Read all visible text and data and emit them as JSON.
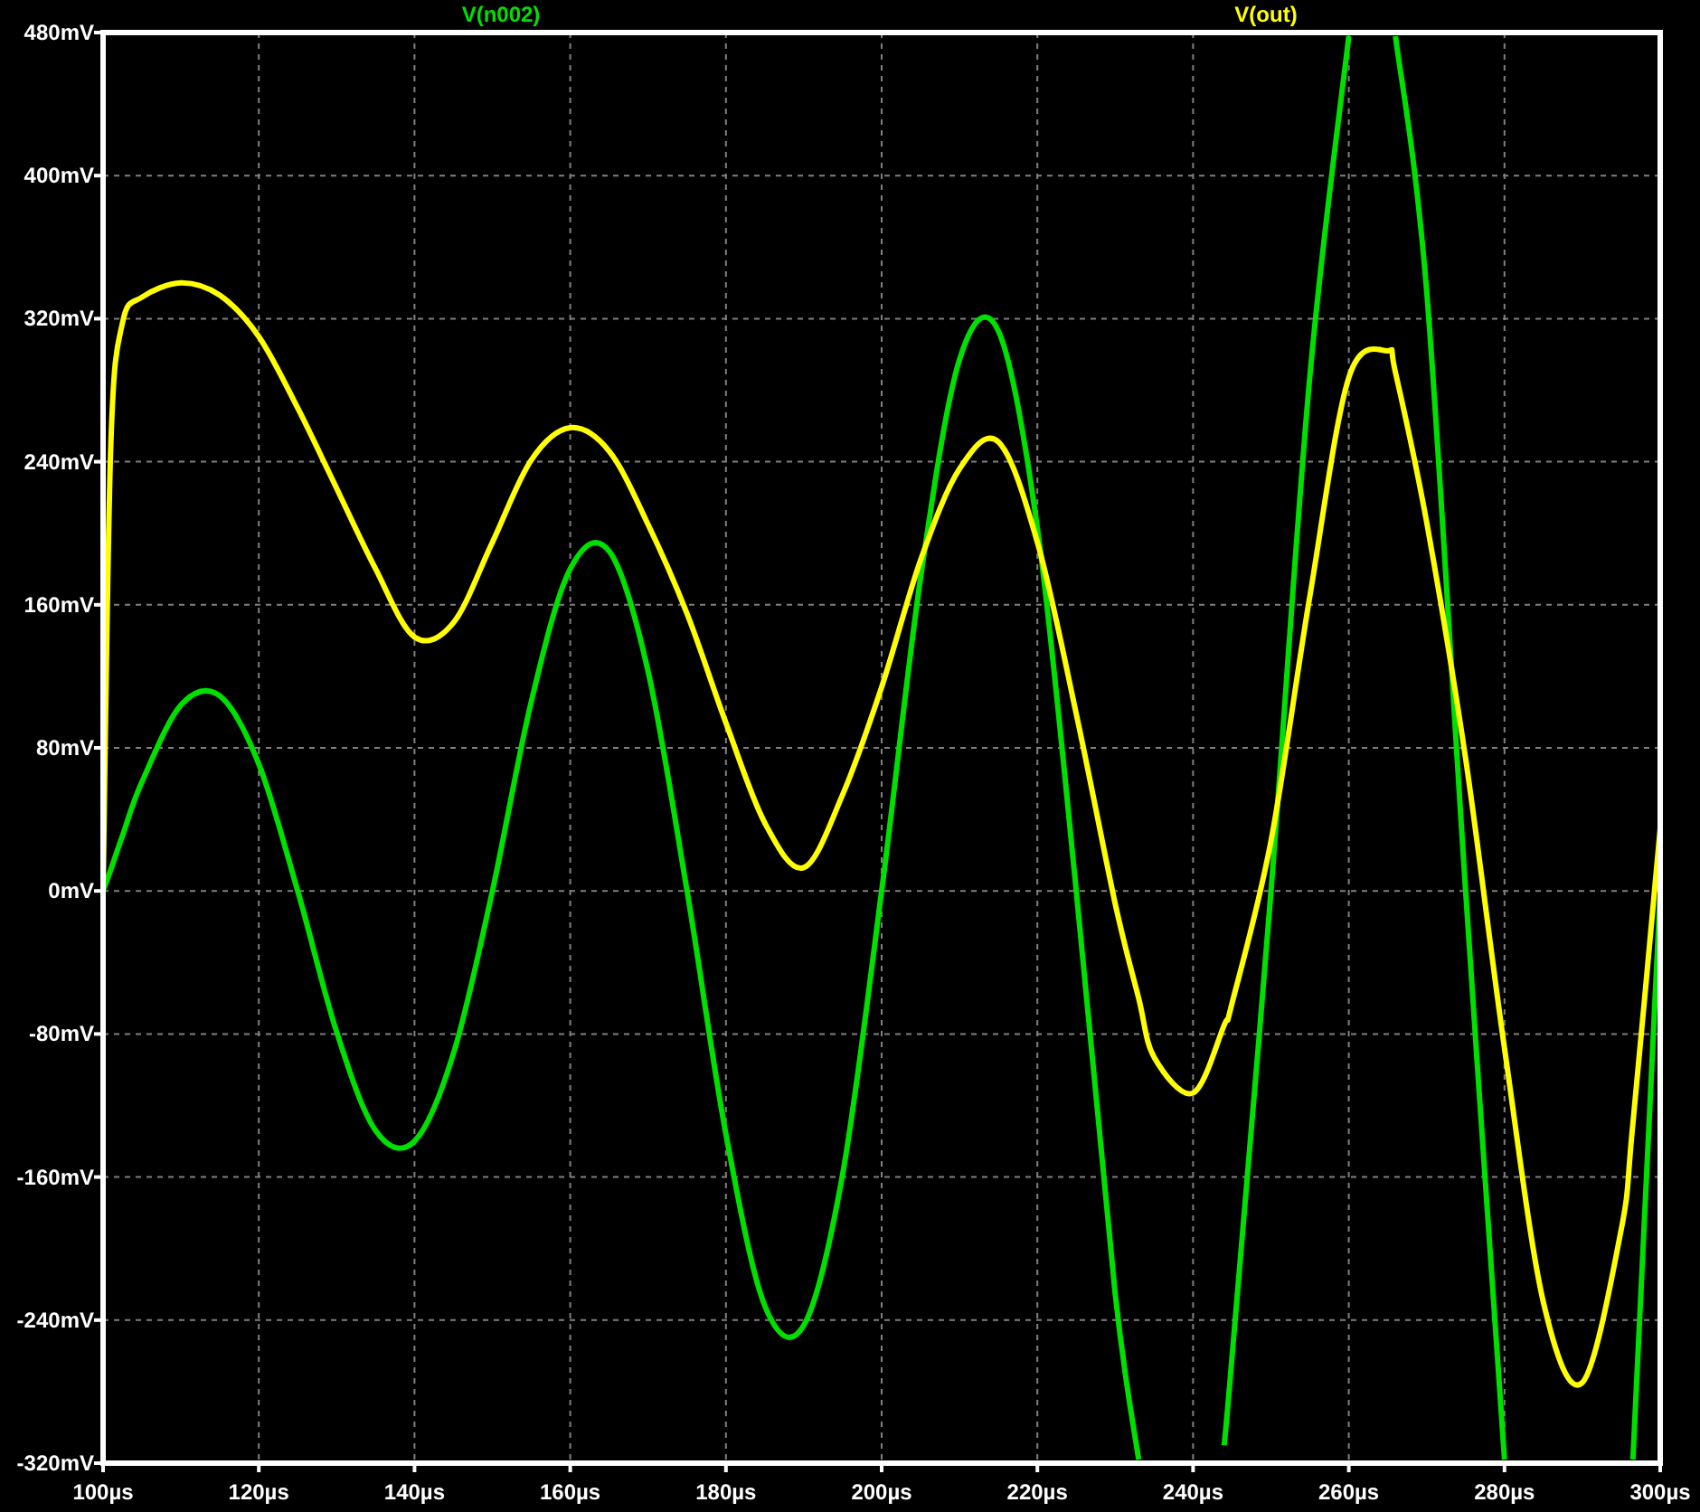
{
  "plot": {
    "chart_data": {
      "type": "line",
      "x": [
        100,
        101,
        102.5,
        105,
        110,
        115,
        120,
        125,
        130,
        135,
        140,
        145,
        150,
        155,
        160,
        165,
        170,
        175,
        180,
        185,
        190,
        195,
        200,
        205,
        210,
        215,
        220,
        225,
        230,
        233,
        235,
        240,
        244,
        245,
        250,
        255,
        260,
        265,
        266,
        270,
        275,
        280,
        285,
        290,
        295,
        296.5,
        300
      ],
      "series": [
        {
          "name": "V(n002)",
          "color": "#00e000",
          "values": [
            0,
            12,
            31,
            61,
            104,
            109,
            71,
            0,
            -79,
            -134,
            -140,
            -91,
            0,
            106,
            180,
            190,
            123,
            0,
            -136,
            -232,
            -243,
            -158,
            0,
            175,
            297,
            313,
            203,
            0,
            -225,
            -318,
            null,
            null,
            -310,
            -261,
            0,
            288,
            478,
            null,
            478,
            335,
            0,
            -318,
            null,
            null,
            null,
            -318,
            0
          ]
        },
        {
          "name": "V(out)",
          "color": "#ffff00",
          "values": [
            0,
            250,
            318,
            332,
            340,
            333,
            310,
            270,
            225,
            180,
            142,
            150,
            195,
            241,
            259,
            246,
            205,
            155,
            94,
            38,
            13,
            54,
            114,
            185,
            236,
            251,
            195,
            99,
            -7,
            -60,
            -93,
            -113,
            -75,
            -63,
            28,
            165,
            287,
            302,
            290,
            206,
            74,
            -88,
            -230,
            -275,
            -189,
            -130,
            35
          ]
        }
      ],
      "xlim": [
        100,
        300
      ],
      "ylim": [
        -320,
        480
      ],
      "grid": true,
      "xticks": [
        {
          "value": 100,
          "label": "100µs"
        },
        {
          "value": 120,
          "label": "120µs"
        },
        {
          "value": 140,
          "label": "140µs"
        },
        {
          "value": 160,
          "label": "160µs"
        },
        {
          "value": 180,
          "label": "180µs"
        },
        {
          "value": 200,
          "label": "200µs"
        },
        {
          "value": 220,
          "label": "220µs"
        },
        {
          "value": 240,
          "label": "240µs"
        },
        {
          "value": 260,
          "label": "260µs"
        },
        {
          "value": 280,
          "label": "280µs"
        },
        {
          "value": 300,
          "label": "300µs"
        }
      ],
      "yticks": [
        {
          "value": -320,
          "label": "-320mV"
        },
        {
          "value": -240,
          "label": "-240mV"
        },
        {
          "value": -160,
          "label": "-160mV"
        },
        {
          "value": -80,
          "label": "-80mV"
        },
        {
          "value": 0,
          "label": "0mV"
        },
        {
          "value": 80,
          "label": "80mV"
        },
        {
          "value": 160,
          "label": "160mV"
        },
        {
          "value": 240,
          "label": "240mV"
        },
        {
          "value": 320,
          "label": "320mV"
        },
        {
          "value": 400,
          "label": "400mV"
        },
        {
          "value": 480,
          "label": "480mV"
        }
      ]
    }
  }
}
